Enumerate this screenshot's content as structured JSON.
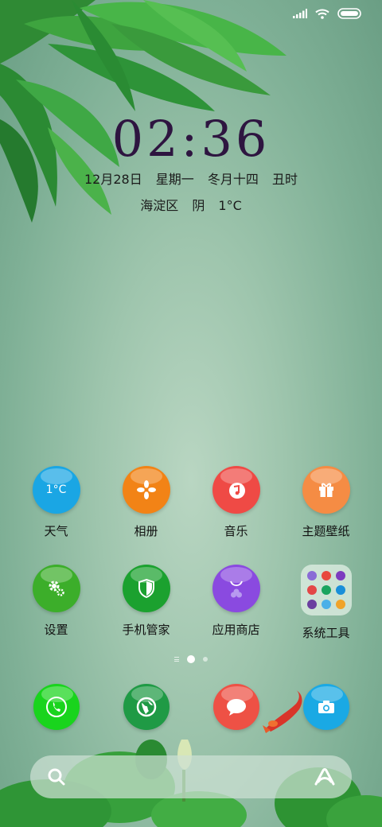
{
  "lock": {
    "time": "02:36",
    "date": "12月28日",
    "weekday": "星期一",
    "lunar_date": "冬月十四",
    "lunar_hour": "丑时",
    "district": "海淀区",
    "weather_condition": "阴",
    "temperature": "1°C"
  },
  "apps": [
    {
      "label": "天气",
      "icon": "weather-icon",
      "color": "#1aa6e4",
      "text": "1°C"
    },
    {
      "label": "相册",
      "icon": "flower-icon",
      "color": "#f28316"
    },
    {
      "label": "音乐",
      "icon": "music-icon",
      "color": "#ef4a45"
    },
    {
      "label": "主题壁纸",
      "icon": "gift-icon",
      "color": "#f58c44"
    },
    {
      "label": "设置",
      "icon": "gear-icon",
      "color": "#3cae2a"
    },
    {
      "label": "手机管家",
      "icon": "shield-icon",
      "color": "#1ba12f"
    },
    {
      "label": "应用商店",
      "icon": "shopping-bag-icon",
      "color": "#8a4ae0"
    },
    {
      "label": "系统工具",
      "icon": "folder-icon",
      "color": "#e6f0ea"
    }
  ],
  "dock": [
    {
      "icon": "phone-icon",
      "color": "#19d41d"
    },
    {
      "icon": "browser-icon",
      "color": "#1f9a45"
    },
    {
      "icon": "message-icon",
      "color": "#ee5145"
    },
    {
      "icon": "camera-icon",
      "color": "#1aa9e4"
    }
  ],
  "folder_colors": [
    "#8a6bd6",
    "#e8483d",
    "#7c3bbf",
    "#e34747",
    "#19a45e",
    "#1a8fd9",
    "#6b3fa0",
    "#4ab0e8",
    "#f0a32a"
  ],
  "page_indicator": {
    "current": 2,
    "total": 3
  }
}
